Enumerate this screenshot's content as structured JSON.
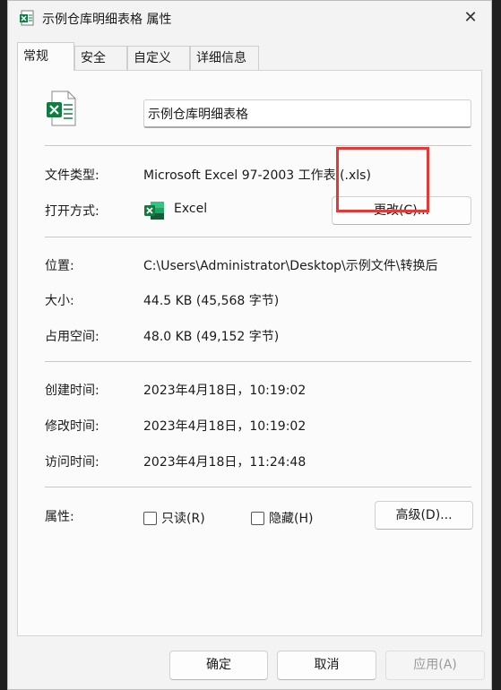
{
  "window": {
    "title": "示例仓库明细表格 属性",
    "close": "✕"
  },
  "tabs": [
    {
      "label": "常规",
      "active": true
    },
    {
      "label": "安全",
      "active": false
    },
    {
      "label": "自定义",
      "active": false
    },
    {
      "label": "详细信息",
      "active": false
    }
  ],
  "general": {
    "file_name": "示例仓库明细表格",
    "file_type_label": "文件类型:",
    "file_type_value": "Microsoft Excel 97-2003 工作表 (.xls)",
    "open_with_label": "打开方式:",
    "open_with_value": "Excel",
    "change_button": "更改(C)...",
    "location_label": "位置:",
    "location_value": "C:\\Users\\Administrator\\Desktop\\示例文件\\转换后",
    "size_label": "大小:",
    "size_value": "44.5 KB (45,568 字节)",
    "size_on_disk_label": "占用空间:",
    "size_on_disk_value": "48.0 KB (49,152 字节)",
    "created_label": "创建时间:",
    "created_value": "2023年4月18日，10:19:02",
    "modified_label": "修改时间:",
    "modified_value": "2023年4月18日，10:19:02",
    "accessed_label": "访问时间:",
    "accessed_value": "2023年4月18日，11:24:48",
    "attributes_label": "属性:",
    "readonly_label": "只读(R)",
    "hidden_label": "隐藏(H)",
    "advanced_button": "高级(D)..."
  },
  "footer": {
    "ok": "确定",
    "cancel": "取消",
    "apply": "应用(A)"
  },
  "colors": {
    "excel_green": "#107c41",
    "highlight_red": "#e53935"
  },
  "icons": {
    "title": "excel-file-icon",
    "file": "excel-file-icon",
    "app": "excel-app-icon"
  }
}
